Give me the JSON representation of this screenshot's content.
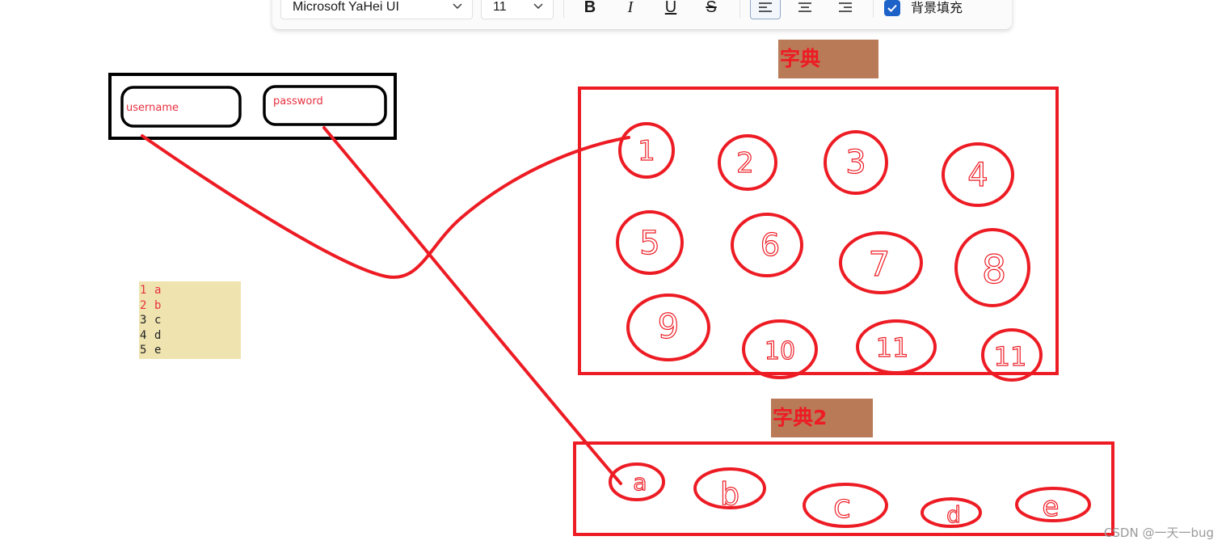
{
  "toolbar": {
    "font_name": "Microsoft YaHei UI",
    "font_size": "11",
    "bold_label": "B",
    "italic_label": "I",
    "underline_label": "U",
    "strike_label": "S",
    "fill_checkbox_checked": true,
    "fill_label": "背景填充",
    "accent_color": "#1d62c9"
  },
  "form_box": {
    "username_label": "username",
    "password_label": "password"
  },
  "dict1": {
    "title": "字典",
    "items": [
      "1",
      "2",
      "3",
      "4",
      "5",
      "6",
      "7",
      "8",
      "9",
      "10",
      "11",
      "11"
    ]
  },
  "dict2": {
    "title": "字典2",
    "items": [
      "a",
      "b",
      "c",
      "d",
      "e"
    ]
  },
  "mini_table": {
    "rows": [
      {
        "key": "1",
        "value": "a",
        "color": "#e8303f"
      },
      {
        "key": "2",
        "value": "b",
        "color": "#e8303f"
      },
      {
        "key": "3",
        "value": "c",
        "color": "#222222"
      },
      {
        "key": "4",
        "value": "d",
        "color": "#222222"
      },
      {
        "key": "5",
        "value": "e",
        "color": "#222222"
      }
    ]
  },
  "watermark": "CSDN @一天一bug",
  "colors": {
    "ink_red": "#ed1c24",
    "ink_black": "#000000",
    "title_bg": "#b97a57",
    "table_bg": "#efe4b0"
  }
}
